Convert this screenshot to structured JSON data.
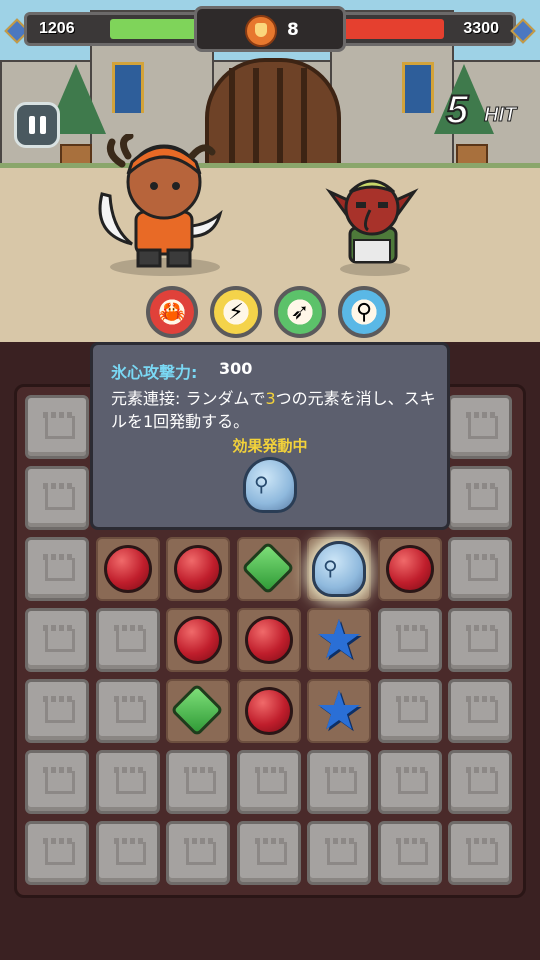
{
  "hud": {
    "player_hp": "1206",
    "player_hp_fraction": 0.55,
    "enemy_hp": "3300",
    "enemy_hp_fraction": 0.62,
    "turn_count": "8",
    "player_bar_color": "#7fd45a",
    "enemy_bar_color": "#e5402f"
  },
  "combo": {
    "count": "5",
    "label": "HIT"
  },
  "skills": [
    {
      "name": "fire-crab-skill",
      "icon": "fire-skill-icon",
      "ring_color": "#e0413a",
      "glyph": "🦀"
    },
    {
      "name": "lightning-skill",
      "icon": "lightning-skill-icon",
      "ring_color": "#f4d34a",
      "glyph": "⚡"
    },
    {
      "name": "wind-arrow-skill",
      "icon": "wind-skill-icon",
      "ring_color": "#5cc26a",
      "glyph": "➶"
    },
    {
      "name": "ice-link-skill",
      "icon": "ice-skill-icon",
      "ring_color": "#5ab8e6",
      "glyph": "⚲"
    }
  ],
  "tooltip": {
    "title_label": "氷心攻撃力:",
    "title_value": "300",
    "desc_part1": "元素連接: ランダムで",
    "desc_highlight": "3",
    "desc_part2": "つの元素を消し、スキルを1回発動する。",
    "status": "効果発動中"
  },
  "board": {
    "rows": [
      [
        "stone",
        "empty",
        "empty",
        "empty",
        "empty",
        "empty",
        "stone"
      ],
      [
        "stone",
        "empty",
        "empty",
        "empty",
        "empty",
        "empty",
        "stone"
      ],
      [
        "stone",
        "red",
        "red",
        "green",
        "special",
        "red",
        "stone"
      ],
      [
        "stone",
        "stone",
        "red",
        "red",
        "blue",
        "stone",
        "stone"
      ],
      [
        "stone",
        "stone",
        "green",
        "red",
        "blue",
        "stone",
        "stone"
      ],
      [
        "stone",
        "stone",
        "stone",
        "stone",
        "stone",
        "stone",
        "stone"
      ],
      [
        "stone",
        "stone",
        "stone",
        "stone",
        "stone",
        "stone",
        "stone"
      ]
    ]
  }
}
